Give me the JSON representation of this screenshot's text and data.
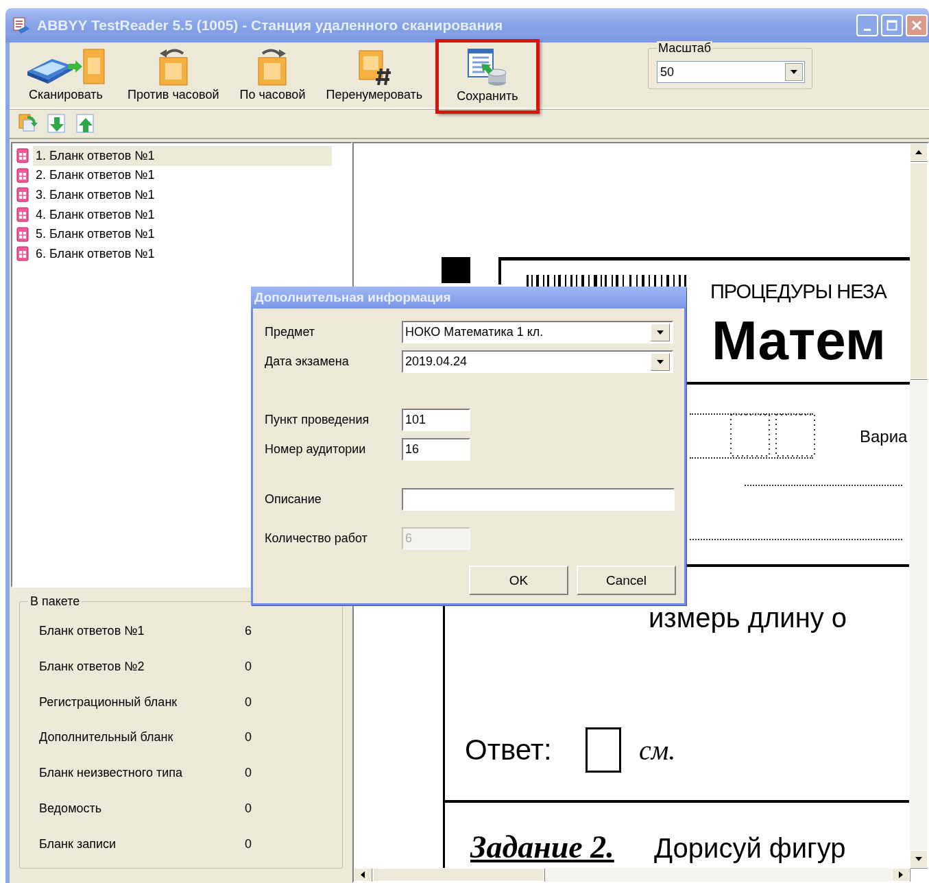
{
  "window": {
    "title": "ABBYY TestReader 5.5 (1005) - Станция удаленного сканирования"
  },
  "toolbar": {
    "buttons": [
      {
        "kind": "scan",
        "label": "Сканировать",
        "highlighted": false
      },
      {
        "kind": "rotate_left",
        "label": "Против часовой",
        "highlighted": false
      },
      {
        "kind": "rotate_right",
        "label": "По часовой",
        "highlighted": false
      },
      {
        "kind": "renumber",
        "label": "Перенумеровать",
        "highlighted": false
      },
      {
        "kind": "save",
        "label": "Сохранить",
        "highlighted": true
      }
    ]
  },
  "zoom": {
    "label": "Масштаб",
    "value": "50"
  },
  "pages": [
    {
      "label": "1. Бланк ответов №1",
      "selected": true
    },
    {
      "label": "2. Бланк ответов №1",
      "selected": false
    },
    {
      "label": "3. Бланк ответов №1",
      "selected": false
    },
    {
      "label": "4. Бланк ответов №1",
      "selected": false
    },
    {
      "label": "5. Бланк ответов №1",
      "selected": false
    },
    {
      "label": "6. Бланк ответов №1",
      "selected": false
    }
  ],
  "batch": {
    "title": "В пакете",
    "rows": [
      {
        "name": "Бланк ответов №1",
        "count": "6"
      },
      {
        "name": "Бланк ответов №2",
        "count": "0"
      },
      {
        "name": "Регистрационный бланк",
        "count": "0"
      },
      {
        "name": "Дополнительный бланк",
        "count": "0"
      },
      {
        "name": "Бланк неизвестного типа",
        "count": "0"
      },
      {
        "name": "Ведомость",
        "count": "0"
      },
      {
        "name": "Бланк записи",
        "count": "0"
      }
    ]
  },
  "document": {
    "header": "ПРОЦЕДУРЫ НЕЗА",
    "subject": "Матем",
    "variant": "Вариа",
    "task1_text": "измерь длину о",
    "answer_label": "Ответ:",
    "answer_unit": "см.",
    "task2_label": "Задание 2.",
    "task2_text": "Дорисуй фигур"
  },
  "dialog": {
    "title": "Дополнительная информация",
    "fields": [
      {
        "kind": "combo",
        "label": "Предмет",
        "value": "НОКО Математика 1 кл.",
        "disabled": false
      },
      {
        "kind": "combo",
        "label": "Дата экзамена",
        "value": "2019.04.24",
        "disabled": false
      },
      {
        "kind": "short",
        "label": "Пункт проведения",
        "value": "101",
        "disabled": false
      },
      {
        "kind": "short",
        "label": "Номер аудитории",
        "value": "16",
        "disabled": false
      },
      {
        "kind": "wide",
        "label": "Описание",
        "disabled": false
      },
      {
        "kind": "short",
        "label": "Количество работ",
        "value": "6",
        "disabled": true
      }
    ],
    "buttons": [
      "OK",
      "Cancel"
    ]
  }
}
